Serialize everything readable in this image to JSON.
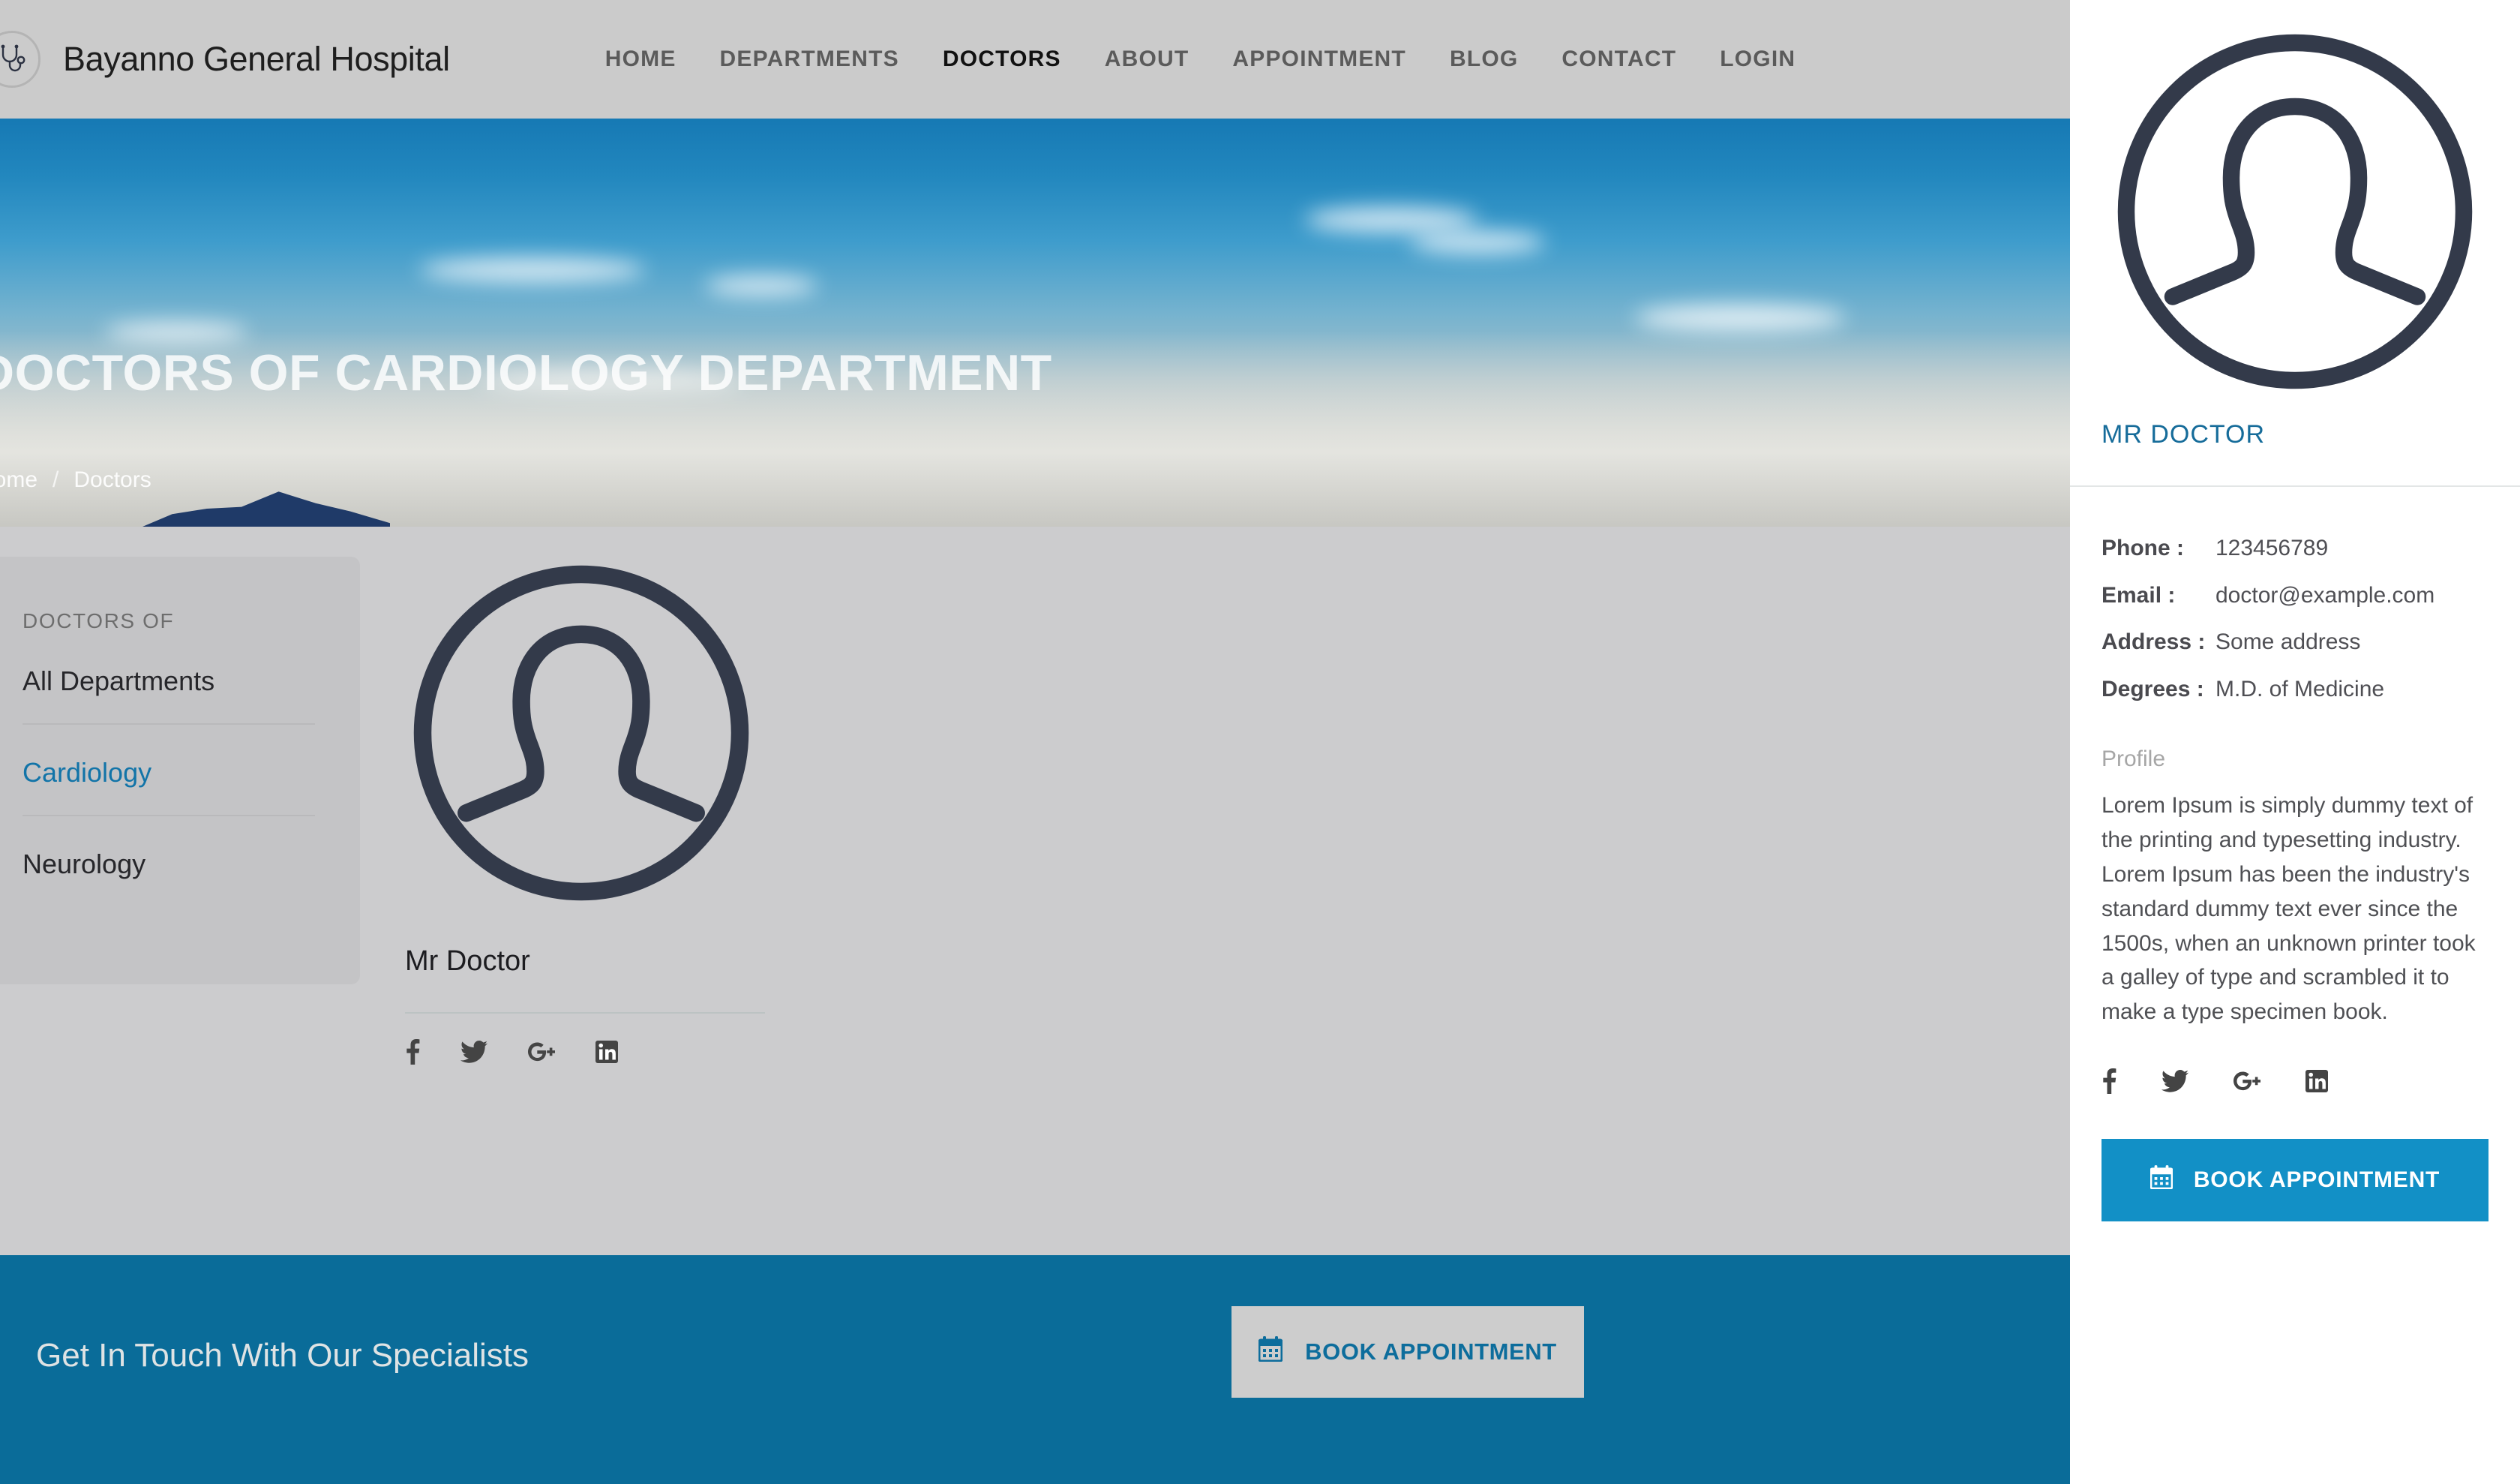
{
  "header": {
    "logo_icon": "stethoscope-icon",
    "brand_name": "Bayanno General Hospital",
    "nav": [
      {
        "label": "HOME",
        "active": false
      },
      {
        "label": "DEPARTMENTS",
        "active": false
      },
      {
        "label": "DOCTORS",
        "active": true
      },
      {
        "label": "ABOUT",
        "active": false
      },
      {
        "label": "APPOINTMENT",
        "active": false
      },
      {
        "label": "BLOG",
        "active": false
      },
      {
        "label": "CONTACT",
        "active": false
      },
      {
        "label": "LOGIN",
        "active": false
      }
    ]
  },
  "hero": {
    "title": "DOCTORS OF CARDIOLOGY DEPARTMENT",
    "breadcrumb": [
      {
        "label": "Home"
      },
      {
        "label": "Doctors"
      }
    ],
    "breadcrumb_separator": "/"
  },
  "sidebar": {
    "title": "DOCTORS OF",
    "items": [
      {
        "label": "All Departments",
        "active": false
      },
      {
        "label": "Cardiology",
        "active": true
      },
      {
        "label": "Neurology",
        "active": false
      }
    ]
  },
  "doctor_card": {
    "avatar_icon": "user-avatar-icon",
    "name": "Mr Doctor",
    "social": [
      {
        "icon": "facebook-icon"
      },
      {
        "icon": "twitter-icon"
      },
      {
        "icon": "google-plus-icon"
      },
      {
        "icon": "linkedin-icon"
      }
    ]
  },
  "footer_cta": {
    "text": "Get In Touch With Our Specialists",
    "button_label": "BOOK APPOINTMENT",
    "button_icon": "calendar-icon",
    "background_color": "#0a6c99",
    "button_bg": "#cdcdcd",
    "button_text_color": "#0d6d9c"
  },
  "panel": {
    "avatar_icon": "user-avatar-icon",
    "name": "MR DOCTOR",
    "name_color": "#166c9a",
    "meta": [
      {
        "label": "Phone :",
        "value": "123456789"
      },
      {
        "label": "Email :",
        "value": "doctor@example.com"
      },
      {
        "label": "Address :",
        "value": "Some address"
      },
      {
        "label": "Degrees :",
        "value": "M.D. of Medicine"
      }
    ],
    "profile_label": "Profile",
    "profile_text": "Lorem Ipsum is simply dummy text of the printing and typesetting industry. Lorem Ipsum has been the industry's standard dummy text ever since the 1500s, when an unknown printer took a galley of type and scrambled it to make a type specimen book.",
    "social": [
      {
        "icon": "facebook-icon"
      },
      {
        "icon": "twitter-icon"
      },
      {
        "icon": "google-plus-icon"
      },
      {
        "icon": "linkedin-icon"
      }
    ],
    "button_label": "BOOK APPOINTMENT",
    "button_icon": "calendar-icon",
    "button_bg": "#1290c6"
  }
}
